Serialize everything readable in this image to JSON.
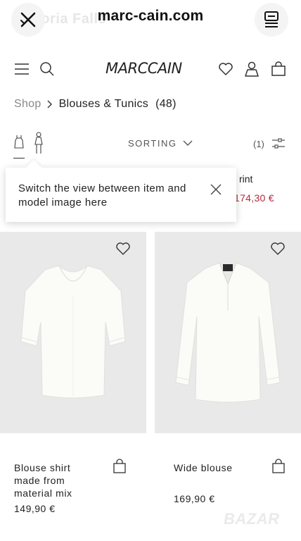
{
  "browser": {
    "url": "marc-cain.com",
    "background_title": "Victoria Falls"
  },
  "header": {
    "logo": "MARCCAIN"
  },
  "breadcrumb": {
    "root": "Shop",
    "current": "Blouses & Tunics",
    "count": "(48)"
  },
  "toolbar": {
    "sorting_label": "SORTING",
    "filter_count": "(1)"
  },
  "behind_tooltip": {
    "name_fragment": "rint",
    "price": "174,30 €",
    "price_color": "#b5283a"
  },
  "tooltip": {
    "text": "Switch the view between item and model image here"
  },
  "products": [
    {
      "name": "Blouse shirt made from material mix",
      "price": "149,90 €"
    },
    {
      "name": "Wide blouse",
      "price": "169,90 €"
    }
  ],
  "watermark": "BAZAR"
}
